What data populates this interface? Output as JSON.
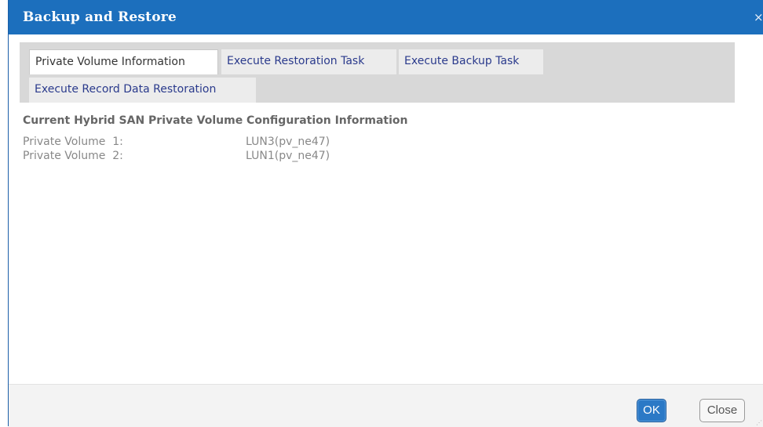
{
  "dialog": {
    "title": "Backup and Restore",
    "close_glyph": "×"
  },
  "tabs": [
    {
      "label": "Private Volume Information",
      "active": true
    },
    {
      "label": "Execute Restoration Task",
      "active": false
    },
    {
      "label": "Execute Backup Task",
      "active": false
    },
    {
      "label": "Execute Record Data Restoration",
      "active": false
    }
  ],
  "content": {
    "section_title": "Current Hybrid SAN Private Volume Configuration Information",
    "rows": [
      {
        "label": "Private Volume  1:",
        "value": "LUN3(pv_ne47)"
      },
      {
        "label": "Private Volume  2:",
        "value": "LUN1(pv_ne47)"
      }
    ]
  },
  "footer": {
    "ok_label": "OK",
    "close_label": "Close"
  },
  "colors": {
    "titlebar": "#1c6fbd",
    "tab_text": "#2a3a8c",
    "ok_button": "#2b79c6"
  },
  "icons": {
    "close": "close-icon",
    "resize": "resize-grip-icon"
  }
}
